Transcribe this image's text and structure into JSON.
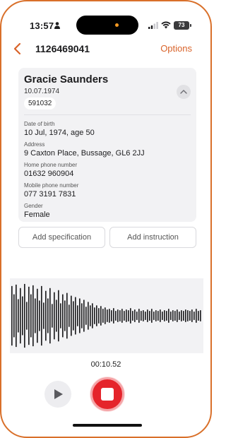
{
  "status_bar": {
    "time": "13:57",
    "battery": "73",
    "icons": [
      "person-icon",
      "signal-icon",
      "wifi-icon",
      "battery-icon"
    ]
  },
  "header": {
    "title": "1126469041",
    "options_label": "Options",
    "back_icon": "chevron-left-icon"
  },
  "patient": {
    "name": "Gracie Saunders",
    "dob_short": "10.07.1974",
    "id": "591032",
    "fields": [
      {
        "label": "Date of birth",
        "value": "10 Jul, 1974, age 50"
      },
      {
        "label": "Address",
        "value": "9 Caxton Place, Bussage, GL6 2JJ"
      },
      {
        "label": "Home phone number",
        "value": "01632 960904"
      },
      {
        "label": "Mobile phone number",
        "value": "077 3191 7831"
      },
      {
        "label": "Gender",
        "value": "Female"
      }
    ]
  },
  "actions": {
    "add_specification": "Add specification",
    "add_instruction": "Add instruction"
  },
  "recording": {
    "elapsed": "00:10.52",
    "amplitudes": [
      0.86,
      0.62,
      0.9,
      0.48,
      0.8,
      0.56,
      0.92,
      0.4,
      0.84,
      0.62,
      0.88,
      0.5,
      0.78,
      0.44,
      0.86,
      0.38,
      0.72,
      0.5,
      0.8,
      0.34,
      0.68,
      0.46,
      0.74,
      0.36,
      0.62,
      0.44,
      0.66,
      0.32,
      0.58,
      0.42,
      0.54,
      0.3,
      0.5,
      0.36,
      0.46,
      0.26,
      0.4,
      0.3,
      0.36,
      0.24,
      0.3,
      0.22,
      0.28,
      0.2,
      0.24,
      0.18,
      0.2,
      0.16,
      0.22,
      0.14,
      0.18,
      0.16,
      0.2,
      0.14,
      0.18,
      0.16,
      0.22,
      0.14,
      0.18,
      0.12,
      0.2,
      0.14,
      0.16,
      0.12,
      0.18,
      0.14,
      0.2,
      0.12,
      0.16,
      0.14,
      0.18,
      0.12,
      0.16,
      0.14,
      0.2,
      0.12,
      0.16,
      0.14,
      0.18,
      0.12,
      0.16,
      0.14,
      0.18,
      0.16,
      0.14,
      0.18,
      0.12,
      0.2,
      0.14,
      0.16
    ],
    "wave_color": "#1c1c1e",
    "record_color": "#e5242b"
  },
  "accent_color": "#d9632a"
}
